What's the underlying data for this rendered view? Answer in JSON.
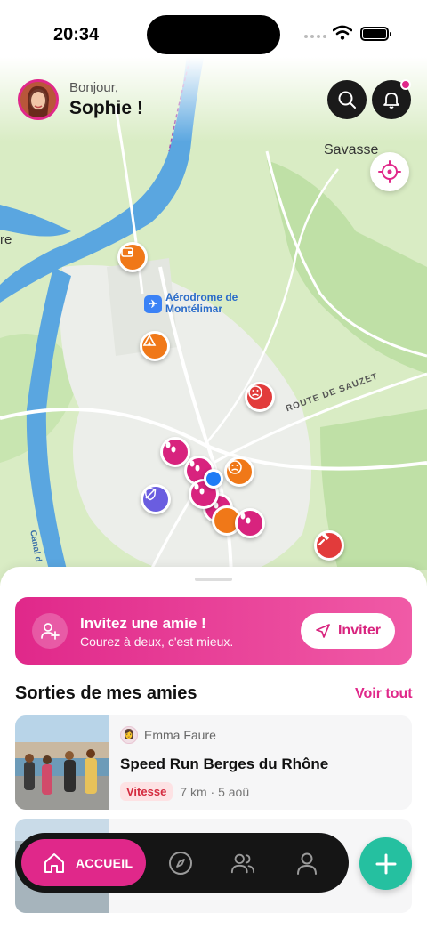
{
  "status_bar": {
    "time": "20:34"
  },
  "header": {
    "greeting": "Bonjour,",
    "user_name": "Sophie !"
  },
  "map": {
    "labels": {
      "savasse": "Savasse",
      "left_edge": "re",
      "airport_line1": "Aérodrome de",
      "airport_line2": "Montélimar",
      "road": "ROUTE DE SAUZET",
      "canal": "Canal d"
    },
    "markers": [
      {
        "type": "orange",
        "icon": "wallet-icon"
      },
      {
        "type": "orange",
        "icon": "tent-icon"
      },
      {
        "type": "red",
        "icon": "sad-face-icon"
      },
      {
        "type": "pink",
        "icon": "footprints-icon"
      },
      {
        "type": "pink",
        "icon": "footprints-icon"
      },
      {
        "type": "orange",
        "icon": "sad-face-icon"
      },
      {
        "type": "purple",
        "icon": "shield-icon"
      },
      {
        "type": "pink",
        "icon": "footprints-icon"
      },
      {
        "type": "pink",
        "icon": "footprints-icon"
      },
      {
        "type": "pink",
        "icon": "footprints-icon"
      },
      {
        "type": "red",
        "icon": "hammer-icon"
      }
    ]
  },
  "invite": {
    "title": "Invitez une amie !",
    "subtitle": "Courez à deux, c'est mieux.",
    "button_label": "Inviter"
  },
  "friends_section": {
    "title": "Sorties de mes amies",
    "see_all": "Voir tout",
    "items": [
      {
        "author": "Emma Faure",
        "title": "Speed Run Berges du Rhône",
        "tag": "Vitesse",
        "meta": "7 km · 5 aoû"
      }
    ]
  },
  "nav": {
    "home_label": "ACCUEIL"
  },
  "colors": {
    "brand_pink": "#e0288a",
    "fab_teal": "#25c0a0",
    "nav_dark": "#151515",
    "marker_orange": "#f07818",
    "marker_red": "#e23b3b",
    "marker_purple": "#6a5de0"
  }
}
